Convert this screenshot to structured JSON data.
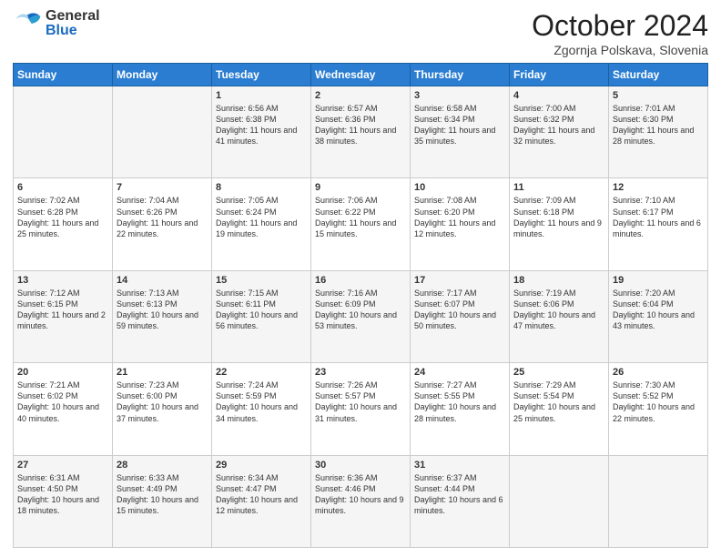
{
  "logo": {
    "general": "General",
    "blue": "Blue"
  },
  "title": "October 2024",
  "location": "Zgornja Polskava, Slovenia",
  "days_of_week": [
    "Sunday",
    "Monday",
    "Tuesday",
    "Wednesday",
    "Thursday",
    "Friday",
    "Saturday"
  ],
  "weeks": [
    [
      {
        "day": "",
        "sunrise": "",
        "sunset": "",
        "daylight": ""
      },
      {
        "day": "",
        "sunrise": "",
        "sunset": "",
        "daylight": ""
      },
      {
        "day": "1",
        "sunrise": "Sunrise: 6:56 AM",
        "sunset": "Sunset: 6:38 PM",
        "daylight": "Daylight: 11 hours and 41 minutes."
      },
      {
        "day": "2",
        "sunrise": "Sunrise: 6:57 AM",
        "sunset": "Sunset: 6:36 PM",
        "daylight": "Daylight: 11 hours and 38 minutes."
      },
      {
        "day": "3",
        "sunrise": "Sunrise: 6:58 AM",
        "sunset": "Sunset: 6:34 PM",
        "daylight": "Daylight: 11 hours and 35 minutes."
      },
      {
        "day": "4",
        "sunrise": "Sunrise: 7:00 AM",
        "sunset": "Sunset: 6:32 PM",
        "daylight": "Daylight: 11 hours and 32 minutes."
      },
      {
        "day": "5",
        "sunrise": "Sunrise: 7:01 AM",
        "sunset": "Sunset: 6:30 PM",
        "daylight": "Daylight: 11 hours and 28 minutes."
      }
    ],
    [
      {
        "day": "6",
        "sunrise": "Sunrise: 7:02 AM",
        "sunset": "Sunset: 6:28 PM",
        "daylight": "Daylight: 11 hours and 25 minutes."
      },
      {
        "day": "7",
        "sunrise": "Sunrise: 7:04 AM",
        "sunset": "Sunset: 6:26 PM",
        "daylight": "Daylight: 11 hours and 22 minutes."
      },
      {
        "day": "8",
        "sunrise": "Sunrise: 7:05 AM",
        "sunset": "Sunset: 6:24 PM",
        "daylight": "Daylight: 11 hours and 19 minutes."
      },
      {
        "day": "9",
        "sunrise": "Sunrise: 7:06 AM",
        "sunset": "Sunset: 6:22 PM",
        "daylight": "Daylight: 11 hours and 15 minutes."
      },
      {
        "day": "10",
        "sunrise": "Sunrise: 7:08 AM",
        "sunset": "Sunset: 6:20 PM",
        "daylight": "Daylight: 11 hours and 12 minutes."
      },
      {
        "day": "11",
        "sunrise": "Sunrise: 7:09 AM",
        "sunset": "Sunset: 6:18 PM",
        "daylight": "Daylight: 11 hours and 9 minutes."
      },
      {
        "day": "12",
        "sunrise": "Sunrise: 7:10 AM",
        "sunset": "Sunset: 6:17 PM",
        "daylight": "Daylight: 11 hours and 6 minutes."
      }
    ],
    [
      {
        "day": "13",
        "sunrise": "Sunrise: 7:12 AM",
        "sunset": "Sunset: 6:15 PM",
        "daylight": "Daylight: 11 hours and 2 minutes."
      },
      {
        "day": "14",
        "sunrise": "Sunrise: 7:13 AM",
        "sunset": "Sunset: 6:13 PM",
        "daylight": "Daylight: 10 hours and 59 minutes."
      },
      {
        "day": "15",
        "sunrise": "Sunrise: 7:15 AM",
        "sunset": "Sunset: 6:11 PM",
        "daylight": "Daylight: 10 hours and 56 minutes."
      },
      {
        "day": "16",
        "sunrise": "Sunrise: 7:16 AM",
        "sunset": "Sunset: 6:09 PM",
        "daylight": "Daylight: 10 hours and 53 minutes."
      },
      {
        "day": "17",
        "sunrise": "Sunrise: 7:17 AM",
        "sunset": "Sunset: 6:07 PM",
        "daylight": "Daylight: 10 hours and 50 minutes."
      },
      {
        "day": "18",
        "sunrise": "Sunrise: 7:19 AM",
        "sunset": "Sunset: 6:06 PM",
        "daylight": "Daylight: 10 hours and 47 minutes."
      },
      {
        "day": "19",
        "sunrise": "Sunrise: 7:20 AM",
        "sunset": "Sunset: 6:04 PM",
        "daylight": "Daylight: 10 hours and 43 minutes."
      }
    ],
    [
      {
        "day": "20",
        "sunrise": "Sunrise: 7:21 AM",
        "sunset": "Sunset: 6:02 PM",
        "daylight": "Daylight: 10 hours and 40 minutes."
      },
      {
        "day": "21",
        "sunrise": "Sunrise: 7:23 AM",
        "sunset": "Sunset: 6:00 PM",
        "daylight": "Daylight: 10 hours and 37 minutes."
      },
      {
        "day": "22",
        "sunrise": "Sunrise: 7:24 AM",
        "sunset": "Sunset: 5:59 PM",
        "daylight": "Daylight: 10 hours and 34 minutes."
      },
      {
        "day": "23",
        "sunrise": "Sunrise: 7:26 AM",
        "sunset": "Sunset: 5:57 PM",
        "daylight": "Daylight: 10 hours and 31 minutes."
      },
      {
        "day": "24",
        "sunrise": "Sunrise: 7:27 AM",
        "sunset": "Sunset: 5:55 PM",
        "daylight": "Daylight: 10 hours and 28 minutes."
      },
      {
        "day": "25",
        "sunrise": "Sunrise: 7:29 AM",
        "sunset": "Sunset: 5:54 PM",
        "daylight": "Daylight: 10 hours and 25 minutes."
      },
      {
        "day": "26",
        "sunrise": "Sunrise: 7:30 AM",
        "sunset": "Sunset: 5:52 PM",
        "daylight": "Daylight: 10 hours and 22 minutes."
      }
    ],
    [
      {
        "day": "27",
        "sunrise": "Sunrise: 6:31 AM",
        "sunset": "Sunset: 4:50 PM",
        "daylight": "Daylight: 10 hours and 18 minutes."
      },
      {
        "day": "28",
        "sunrise": "Sunrise: 6:33 AM",
        "sunset": "Sunset: 4:49 PM",
        "daylight": "Daylight: 10 hours and 15 minutes."
      },
      {
        "day": "29",
        "sunrise": "Sunrise: 6:34 AM",
        "sunset": "Sunset: 4:47 PM",
        "daylight": "Daylight: 10 hours and 12 minutes."
      },
      {
        "day": "30",
        "sunrise": "Sunrise: 6:36 AM",
        "sunset": "Sunset: 4:46 PM",
        "daylight": "Daylight: 10 hours and 9 minutes."
      },
      {
        "day": "31",
        "sunrise": "Sunrise: 6:37 AM",
        "sunset": "Sunset: 4:44 PM",
        "daylight": "Daylight: 10 hours and 6 minutes."
      },
      {
        "day": "",
        "sunrise": "",
        "sunset": "",
        "daylight": ""
      },
      {
        "day": "",
        "sunrise": "",
        "sunset": "",
        "daylight": ""
      }
    ]
  ]
}
